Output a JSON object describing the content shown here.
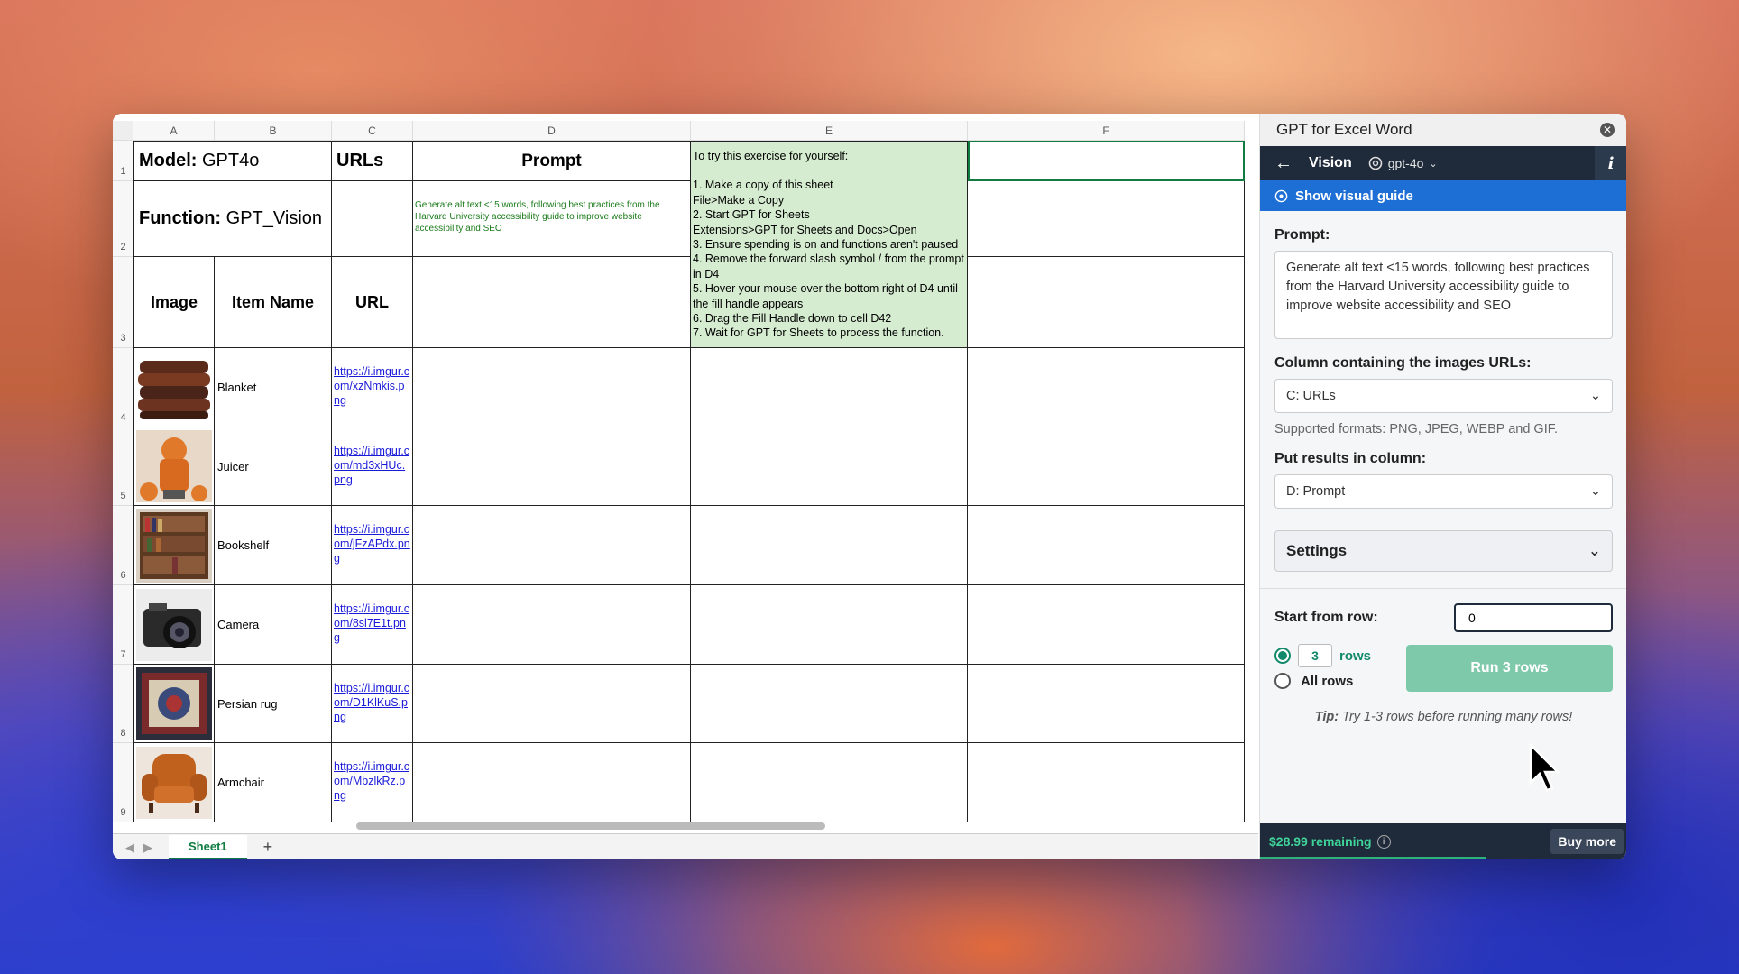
{
  "sheet": {
    "columns": [
      "A",
      "B",
      "C",
      "D",
      "E",
      "F"
    ],
    "rows": [
      "1",
      "2",
      "3",
      "4",
      "5",
      "6",
      "7",
      "8",
      "9"
    ],
    "model_label": "Model:",
    "model_value": "GPT4o",
    "function_label": "Function:",
    "function_value": "GPT_Vision",
    "urls_header": "URLs",
    "prompt_header": "Prompt",
    "prompt_text": "Generate alt text <15 words, following best practices from the Harvard University accessibility guide to improve website accessibility and SEO",
    "image_header": "Image",
    "item_header": "Item Name",
    "url_header": "URL",
    "instructions": [
      "To try this exercise for yourself:",
      "",
      "1. Make a copy of this sheet",
      "File>Make a Copy",
      "2. Start GPT for Sheets",
      "Extensions>GPT for Sheets and Docs>Open",
      "3. Ensure spending is on and functions aren't paused",
      "4. Remove the forward slash symbol / from the prompt in D4",
      "5. Hover your mouse over the bottom right of D4 until the fill handle appears",
      "6. Drag the Fill Handle down to cell D42",
      "7. Wait for GPT for Sheets to process the function."
    ],
    "items": [
      {
        "name": "Blanket",
        "url": "https://i.imgur.com/xzNmkis.png"
      },
      {
        "name": "Juicer",
        "url": "https://i.imgur.com/md3xHUc.png"
      },
      {
        "name": "Bookshelf",
        "url": "https://i.imgur.com/jFzAPdx.png"
      },
      {
        "name": "Camera",
        "url": "https://i.imgur.com/8sl7E1t.png"
      },
      {
        "name": "Persian rug",
        "url": "https://i.imgur.com/D1KlKuS.png"
      },
      {
        "name": "Armchair",
        "url": "https://i.imgur.com/MbzlkRz.png"
      }
    ],
    "tab_name": "Sheet1",
    "add_tab": "+"
  },
  "panel": {
    "title": "GPT for Excel Word",
    "nav_title": "Vision",
    "model": "gpt-4o",
    "info": "i",
    "guide": "Show visual guide",
    "prompt_label": "Prompt:",
    "prompt_value": "Generate alt text <15 words, following best practices from the Harvard University accessibility guide to improve website accessibility and SEO",
    "column_label": "Column containing the images URLs:",
    "column_value": "C: URLs",
    "formats": "Supported formats: PNG, JPEG, WEBP and GIF.",
    "results_label": "Put results in column:",
    "results_value": "D: Prompt",
    "settings": "Settings",
    "start_label": "Start from row:",
    "start_value": "0",
    "rows_count": "3",
    "rows_label": "rows",
    "all_rows": "All rows",
    "run_button": "Run 3 rows",
    "tip_prefix": "Tip:",
    "tip_text": "Try 1-3 rows before running many rows!",
    "remaining": "$28.99 remaining",
    "buy_more": "Buy more"
  },
  "colors": {
    "accent_green": "#13896b",
    "nav_dark": "#1f2a3a",
    "guide_blue": "#1d6fd6",
    "instructions_bg": "#d6ecd1"
  }
}
